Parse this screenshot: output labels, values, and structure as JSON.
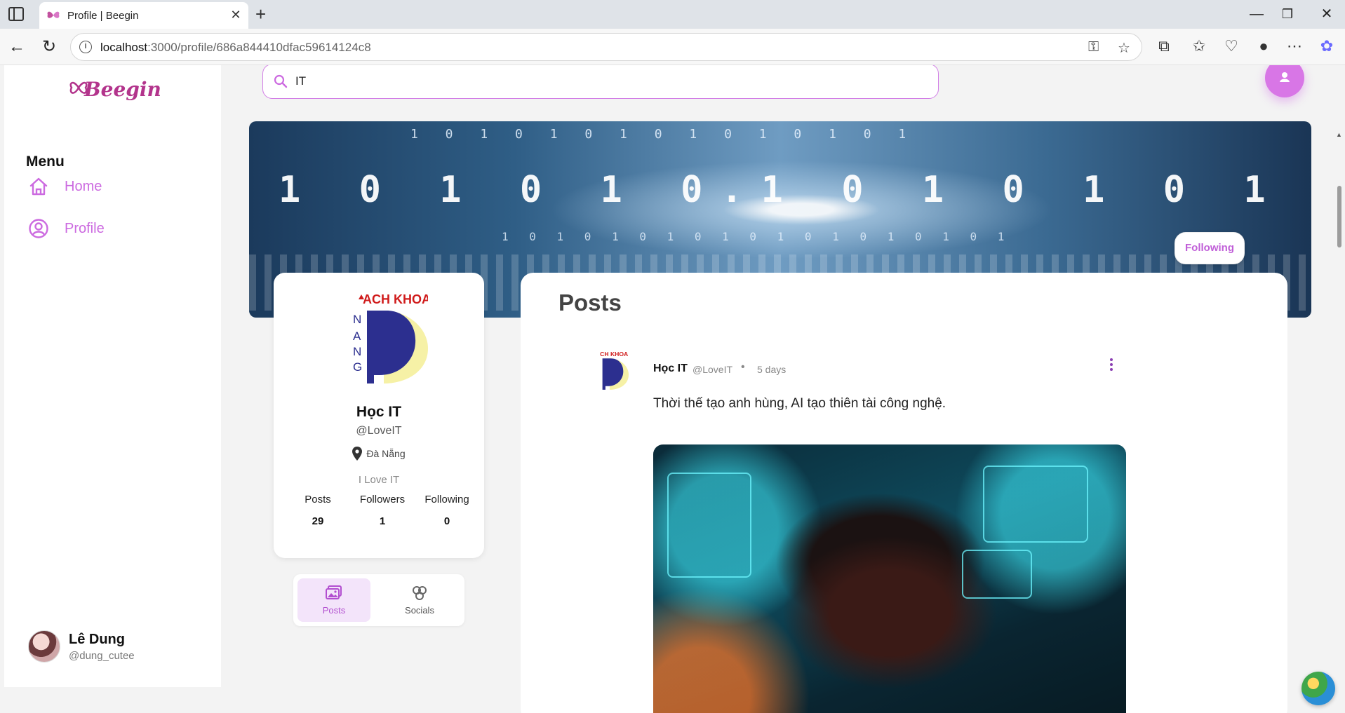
{
  "browser": {
    "tab_title": "Profile | Beegin",
    "url_host": "localhost",
    "url_rest": ":3000/profile/686a844410dfac59614124c8"
  },
  "app": {
    "logo_text": "Beegin",
    "menu_title": "Menu",
    "nav": [
      {
        "label": "Home",
        "icon": "home-icon"
      },
      {
        "label": "Profile",
        "icon": "user-circle-icon"
      }
    ],
    "accent_color": "#cc6ae0",
    "current_user": {
      "name": "Lê Dung",
      "handle": "@dung_cutee"
    }
  },
  "search": {
    "value": "IT"
  },
  "cover": {
    "digits_big": "1 0 1 0 1 0.1 0 1 0 1 0 1 0 1 0 1 0",
    "digits_top": "1 0 1 0 1 0 1 0 1 0 1 0 1 0 1",
    "digits_mid": "1 0 1 0 1 0 1 0 1 0 1 0 1 0 1 0 1 0 1",
    "follow_button": "Following"
  },
  "profile": {
    "name": "Học IT",
    "handle": "@LoveIT",
    "location": "Đà Nẵng",
    "bio": "I Love IT",
    "avatar_text": "ACH KHOA",
    "avatar_side": "NANG",
    "stats": [
      {
        "label": "Posts",
        "value": "29"
      },
      {
        "label": "Followers",
        "value": "1"
      },
      {
        "label": "Following",
        "value": "0"
      }
    ],
    "tabs": [
      {
        "label": "Posts",
        "icon": "images-icon",
        "active": true
      },
      {
        "label": "Socials",
        "icon": "socials-icon",
        "active": false
      }
    ]
  },
  "posts": {
    "title": "Posts",
    "items": [
      {
        "author": "Học IT",
        "handle": "@LoveIT",
        "dot": "•",
        "time": "5 days",
        "text": "Thời thế tạo anh hùng, AI tạo thiên tài công nghệ."
      }
    ]
  }
}
